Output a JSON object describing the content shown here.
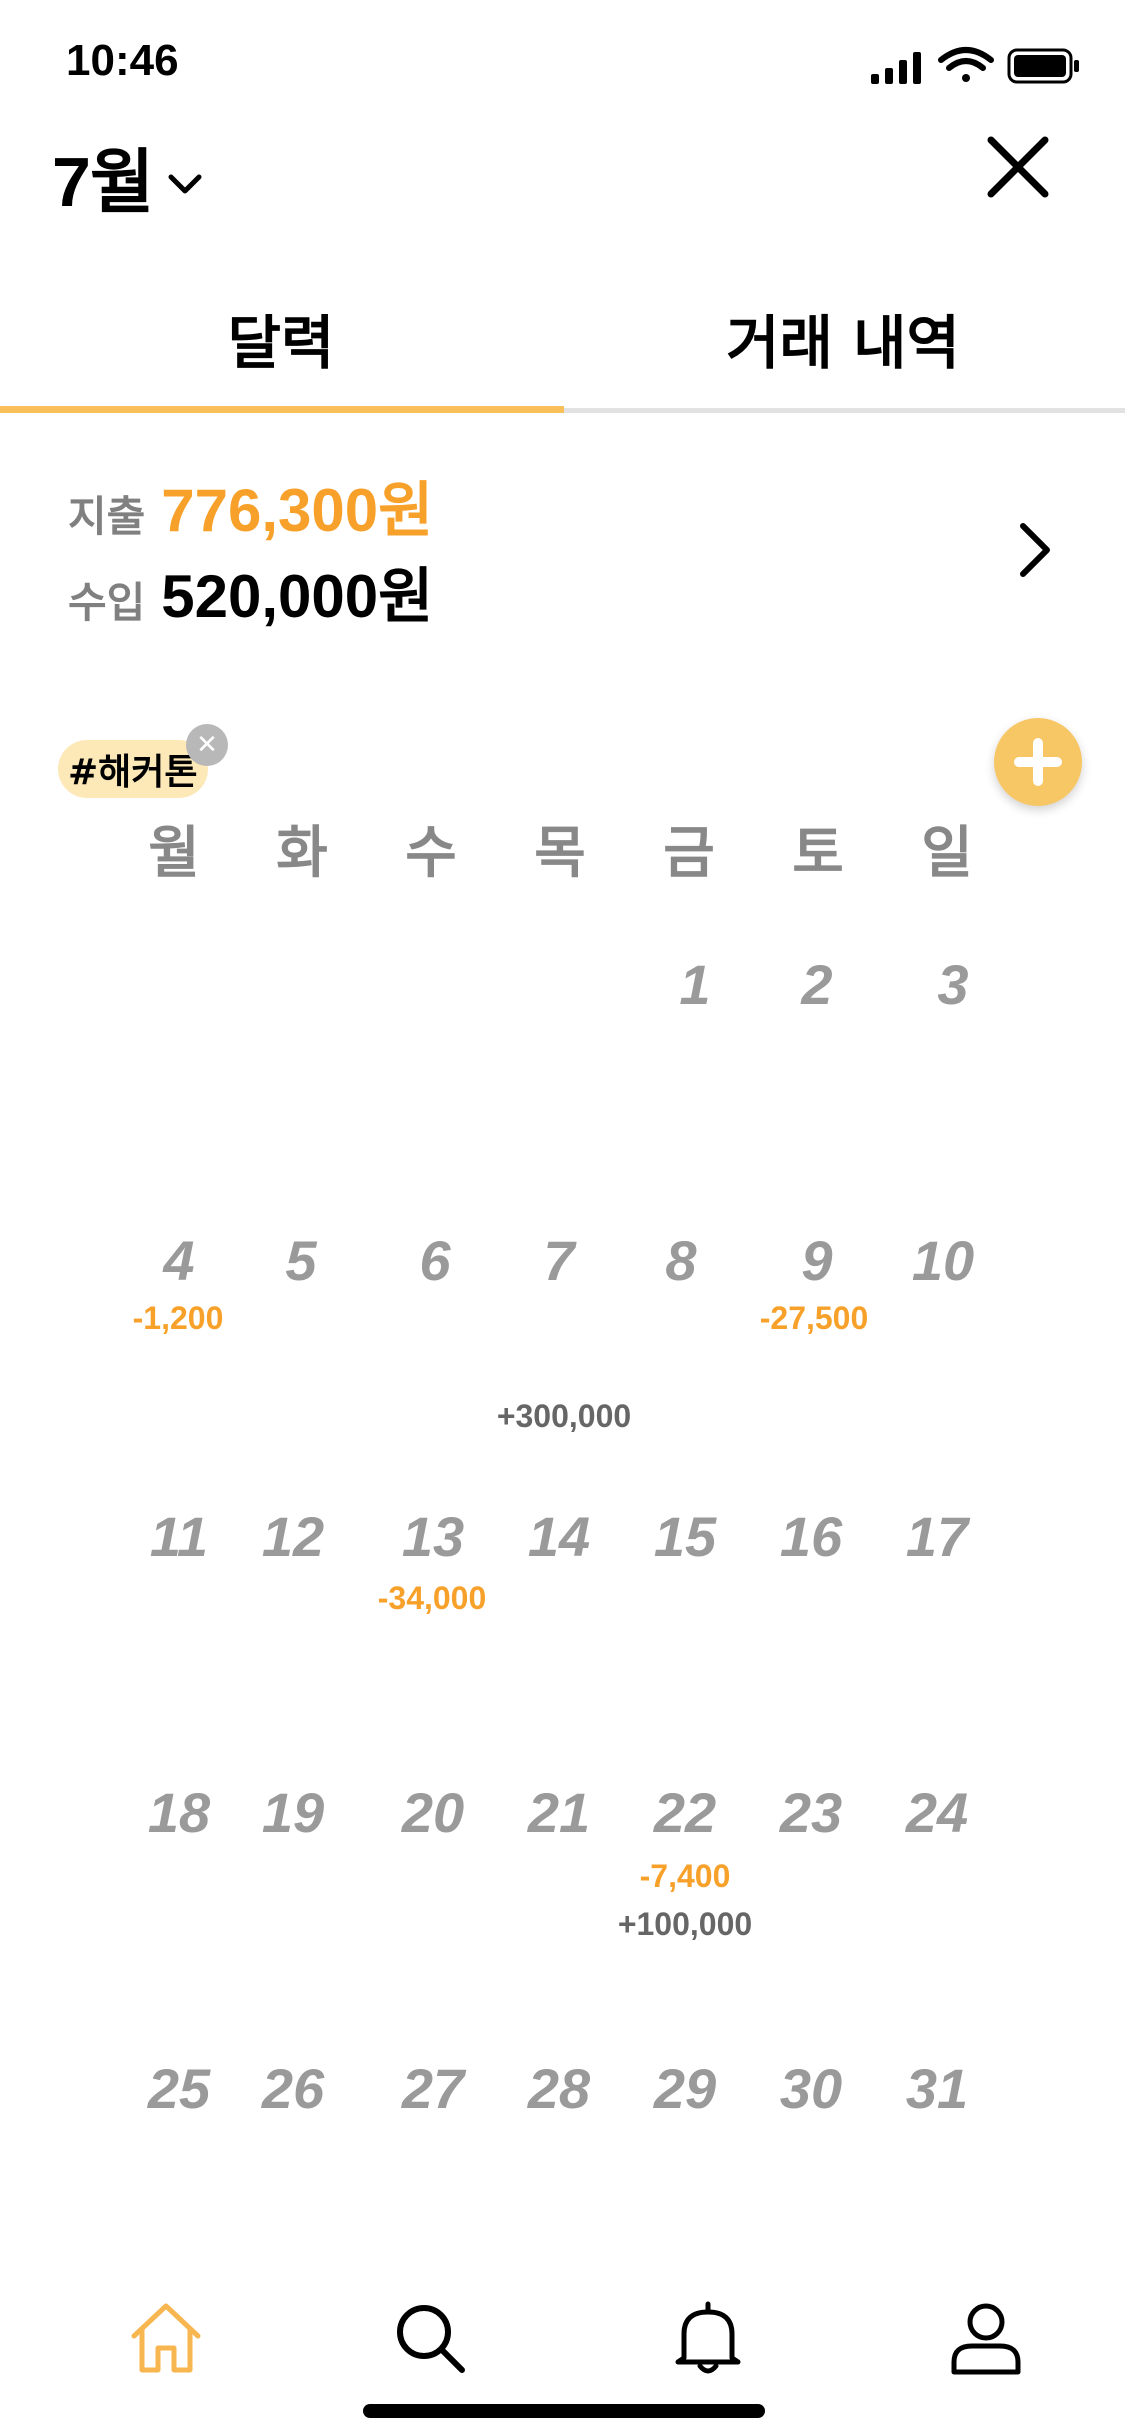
{
  "status_bar": {
    "time": "10:46"
  },
  "header": {
    "month": "7월"
  },
  "tabs": [
    {
      "label": "달력",
      "active": true
    },
    {
      "label": "거래 내역",
      "active": false
    }
  ],
  "summary": {
    "expense_label": "지출",
    "expense_value": "776,300원",
    "income_label": "수입",
    "income_value": "520,000원"
  },
  "tag": {
    "label": "#해커톤"
  },
  "calendar": {
    "weekdays": [
      "월",
      "화",
      "수",
      "목",
      "금",
      "토",
      "일"
    ],
    "days": [
      "1",
      "2",
      "3",
      "4",
      "5",
      "6",
      "7",
      "8",
      "9",
      "10",
      "11",
      "12",
      "13",
      "14",
      "15",
      "16",
      "17",
      "18",
      "19",
      "20",
      "21",
      "22",
      "23",
      "24",
      "25",
      "26",
      "27",
      "28",
      "29",
      "30",
      "31"
    ],
    "amounts": [
      {
        "day": 4,
        "text": "-1,200",
        "kind": "expense"
      },
      {
        "day": 9,
        "text": "-27,500",
        "kind": "expense"
      },
      {
        "day": 7,
        "text": "+300,000",
        "kind": "income"
      },
      {
        "day": 13,
        "text": "-34,000",
        "kind": "expense"
      },
      {
        "day": 22,
        "text": "-7,400",
        "kind": "expense"
      },
      {
        "day": 22,
        "text": "+100,000",
        "kind": "income"
      }
    ]
  },
  "colors": {
    "accent": "#f7a12b",
    "fab": "#f8c765",
    "tag_bg": "#fde8b8"
  },
  "bottom_nav": [
    "home-icon",
    "search-icon",
    "bell-icon",
    "profile-icon"
  ]
}
